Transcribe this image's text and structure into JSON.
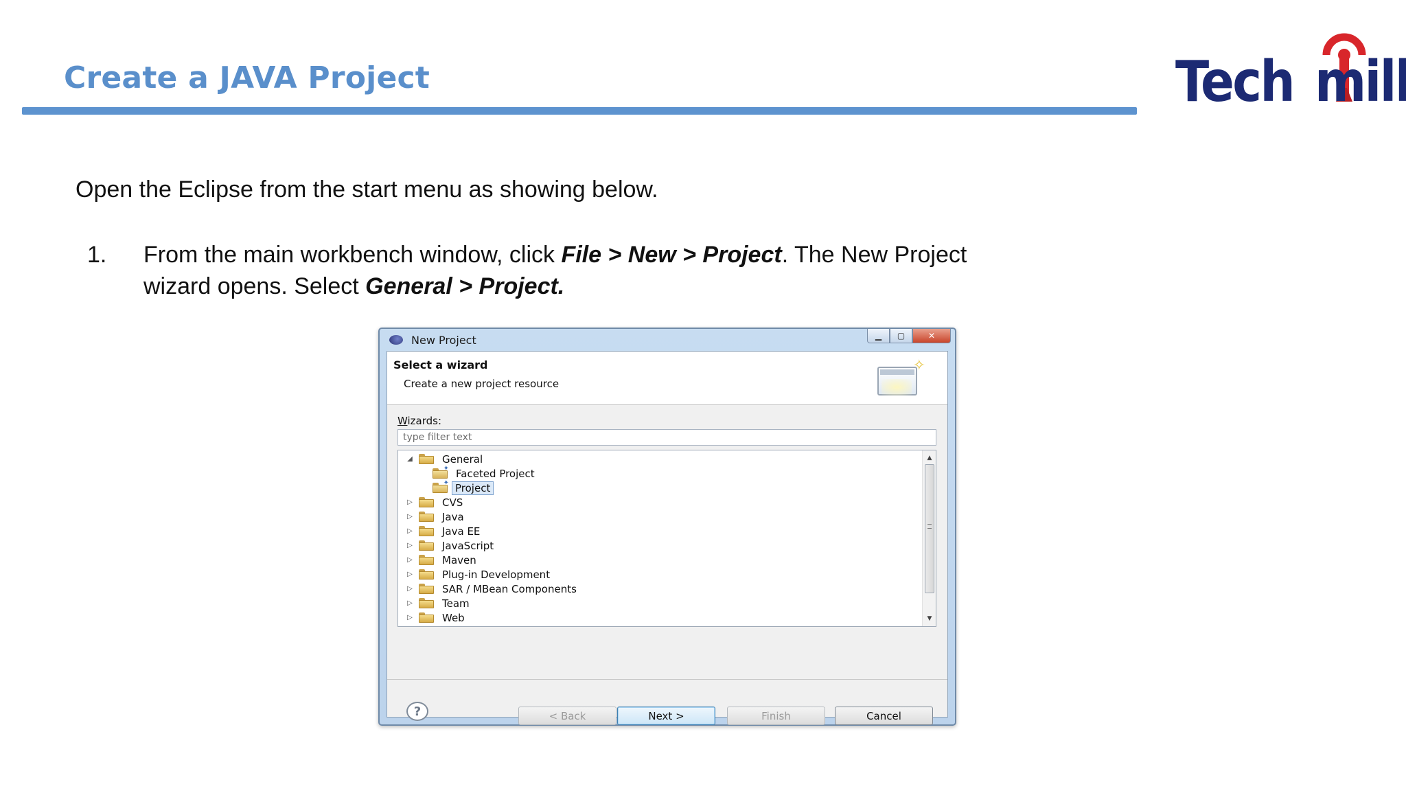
{
  "slide": {
    "title": "Create a JAVA Project",
    "intro": "Open the Eclipse from the start menu as showing below.",
    "step": {
      "number": "1.",
      "text_1": "From the main workbench window, click ",
      "bold_1": "File > New > Project",
      "text_2": ". The New Project wizard opens. Select ",
      "bold_2": "General > Project."
    }
  },
  "logo": {
    "part1": "Tech",
    "part2": "mill",
    "colors": {
      "text": "#1c2a73",
      "accent": "#d8262b"
    }
  },
  "dialog": {
    "title": "New Project",
    "heading": "Select a wizard",
    "subheading": "Create a new project resource",
    "wizards_label_hotkey": "W",
    "wizards_label_rest": "izards:",
    "filter_placeholder": "type filter text",
    "tree": [
      {
        "label": "General",
        "expanded": true,
        "depth": 0
      },
      {
        "label": "Faceted Project",
        "depth": 1
      },
      {
        "label": "Project",
        "depth": 1,
        "selected": true
      },
      {
        "label": "CVS",
        "depth": 0
      },
      {
        "label": "Java",
        "depth": 0
      },
      {
        "label": "Java EE",
        "depth": 0
      },
      {
        "label": "JavaScript",
        "depth": 0
      },
      {
        "label": "Maven",
        "depth": 0
      },
      {
        "label": "Plug-in Development",
        "depth": 0
      },
      {
        "label": "SAR / MBean Components",
        "depth": 0
      },
      {
        "label": "Team",
        "depth": 0
      },
      {
        "label": "Web",
        "depth": 0
      }
    ],
    "buttons": {
      "back": "< Back",
      "next": "Next >",
      "finish": "Finish",
      "cancel": "Cancel"
    },
    "help_glyph": "?",
    "colors": {
      "accent": "#5a8fcb",
      "frame": "#c7dcf1"
    }
  }
}
